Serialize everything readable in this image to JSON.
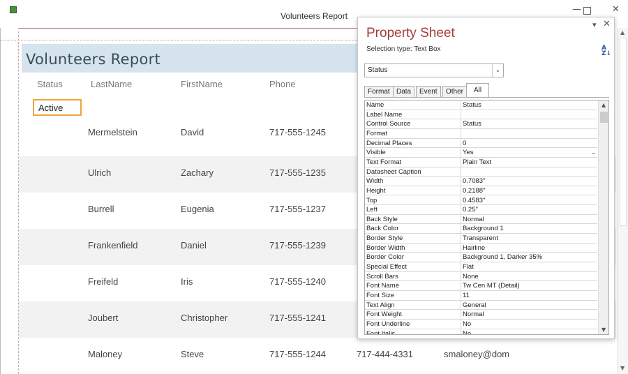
{
  "window": {
    "title": "Volunteers Report"
  },
  "report": {
    "title": "Volunteers Report",
    "columns": [
      "Status",
      "LastName",
      "FirstName",
      "Phone"
    ],
    "status_value": "Active",
    "rows": [
      {
        "last": "Mermelstein",
        "first": "David",
        "phone": "717-555-1245"
      },
      {
        "last": "Ulrich",
        "first": "Zachary",
        "phone": "717-555-1235"
      },
      {
        "last": "Burrell",
        "first": "Eugenia",
        "phone": "717-555-1237"
      },
      {
        "last": "Frankenfield",
        "first": "Daniel",
        "phone": "717-555-1239"
      },
      {
        "last": "Freifeld",
        "first": "Iris",
        "phone": "717-555-1240"
      },
      {
        "last": "Joubert",
        "first": "Christopher",
        "phone": "717-555-1241"
      },
      {
        "last": "Maloney",
        "first": "Steve",
        "phone": "717-555-1244",
        "phone2": "717-444-4331",
        "email": "smaloney@dom"
      }
    ]
  },
  "property_sheet": {
    "title": "Property Sheet",
    "selection_type": "Selection type:  Text Box",
    "selected_control": "Status",
    "tabs": [
      "Format",
      "Data",
      "Event",
      "Other",
      "All"
    ],
    "active_tab": "All",
    "properties": [
      {
        "name": "Name",
        "value": "Status"
      },
      {
        "name": "Label Name",
        "value": ""
      },
      {
        "name": "Control Source",
        "value": "Status"
      },
      {
        "name": "Format",
        "value": ""
      },
      {
        "name": "Decimal Places",
        "value": "0"
      },
      {
        "name": "Visible",
        "value": "Yes"
      },
      {
        "name": "Text Format",
        "value": "Plain Text"
      },
      {
        "name": "Datasheet Caption",
        "value": ""
      },
      {
        "name": "Width",
        "value": "0.7083\""
      },
      {
        "name": "Height",
        "value": "0.2188\""
      },
      {
        "name": "Top",
        "value": "0.4583\""
      },
      {
        "name": "Left",
        "value": "0.25\""
      },
      {
        "name": "Back Style",
        "value": "Normal"
      },
      {
        "name": "Back Color",
        "value": "Background 1"
      },
      {
        "name": "Border Style",
        "value": "Transparent"
      },
      {
        "name": "Border Width",
        "value": "Hairline"
      },
      {
        "name": "Border Color",
        "value": "Background 1, Darker 35%"
      },
      {
        "name": "Special Effect",
        "value": "Flat"
      },
      {
        "name": "Scroll Bars",
        "value": "None"
      },
      {
        "name": "Font Name",
        "value": "Tw Cen MT (Detail)"
      },
      {
        "name": "Font Size",
        "value": "11"
      },
      {
        "name": "Text Align",
        "value": "General"
      },
      {
        "name": "Font Weight",
        "value": "Normal"
      },
      {
        "name": "Font Underline",
        "value": "No"
      },
      {
        "name": "Font Italic",
        "value": "No"
      }
    ]
  },
  "icons": {
    "app": "access-report-icon",
    "minimize": "minimize-icon",
    "maximize": "maximize-icon",
    "close": "close-icon",
    "sort": "sort-az-icon"
  },
  "colors": {
    "banner": "#d6e4ee",
    "selection_border": "#f0a33b",
    "property_sheet_title": "#a33b3b",
    "alt_row": "#f2f2f2"
  }
}
